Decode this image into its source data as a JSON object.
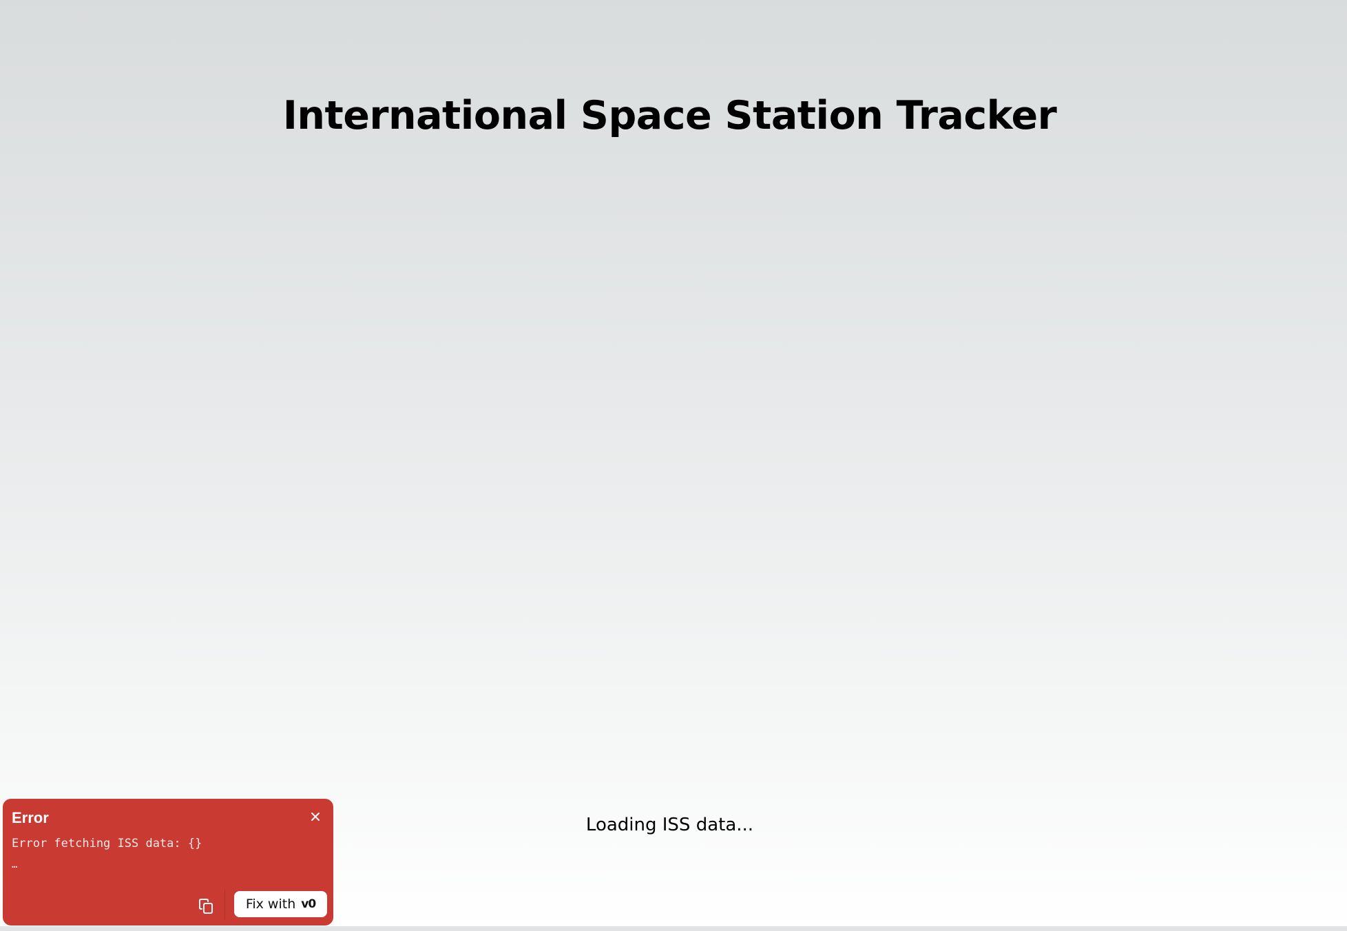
{
  "page": {
    "title": "International Space Station Tracker",
    "loading_text": "Loading ISS data..."
  },
  "error_toast": {
    "title": "Error",
    "message": "Error fetching ISS data: {}",
    "ellipsis": "…",
    "fix_label": "Fix with",
    "fix_logo": "v0",
    "icons": {
      "close": "close-icon",
      "copy": "copy-icon"
    },
    "colors": {
      "background": "#c93a33",
      "button_bg": "#ffffff"
    }
  }
}
